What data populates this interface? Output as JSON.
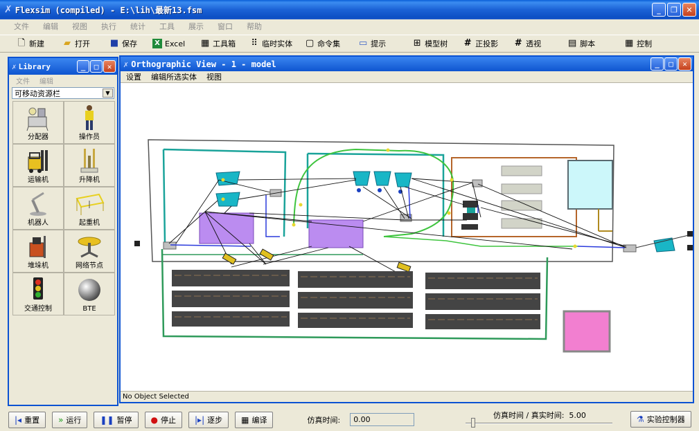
{
  "window": {
    "title": "Flexsim (compiled) - E:\\lih\\最新13.fsm",
    "controls": [
      "_",
      "❐",
      "✕"
    ]
  },
  "menu": [
    "文件",
    "编辑",
    "视图",
    "执行",
    "统计",
    "工具",
    "展示",
    "窗口",
    "帮助"
  ],
  "toolbar": [
    {
      "label": "新建",
      "icon": "new-file-icon",
      "glyph": "🗋"
    },
    {
      "label": "打开",
      "icon": "open-folder-icon",
      "glyph": "📂"
    },
    {
      "label": "保存",
      "icon": "save-disk-icon",
      "glyph": "💾"
    },
    {
      "label": "Excel",
      "icon": "excel-icon",
      "glyph": "X"
    },
    {
      "label": "工具箱",
      "icon": "toolbox-icon",
      "glyph": "▦"
    },
    {
      "label": "临时实体",
      "icon": "flowitem-icon",
      "glyph": "⠿"
    },
    {
      "label": "命令集",
      "icon": "command-icon",
      "glyph": "▢"
    },
    {
      "label": "提示",
      "icon": "tip-icon",
      "glyph": "▭"
    },
    {
      "label": "模型树",
      "icon": "tree-icon",
      "glyph": "⊞"
    },
    {
      "label": "正投影",
      "icon": "ortho-grid-icon",
      "glyph": "#"
    },
    {
      "label": "透视",
      "icon": "perspective-icon",
      "glyph": "#"
    },
    {
      "label": "脚本",
      "icon": "script-icon",
      "glyph": "▤"
    },
    {
      "label": "控制",
      "icon": "control-icon",
      "glyph": "▦"
    }
  ],
  "library": {
    "title": "Library",
    "menu": [
      "文件",
      "编辑"
    ],
    "selected_group": "可移动资源栏",
    "items": [
      {
        "label": "分配器",
        "icon": "dispatcher-icon"
      },
      {
        "label": "操作员",
        "icon": "operator-icon"
      },
      {
        "label": "运输机",
        "icon": "transporter-icon"
      },
      {
        "label": "升降机",
        "icon": "elevator-icon"
      },
      {
        "label": "机器人",
        "icon": "robot-icon"
      },
      {
        "label": "起重机",
        "icon": "crane-icon"
      },
      {
        "label": "堆垛机",
        "icon": "asrs-icon"
      },
      {
        "label": "网络节点",
        "icon": "network-node-icon"
      },
      {
        "label": "交通控制",
        "icon": "traffic-light-icon"
      },
      {
        "label": "BTE",
        "icon": "bte-sphere-icon"
      }
    ]
  },
  "view": {
    "title": "Orthographic View - 1 - model",
    "menu": [
      "设置",
      "编辑所选实体",
      "视图"
    ],
    "status": "No Object Selected"
  },
  "controls": {
    "reset": "重置",
    "run": "运行",
    "pause": "暂停",
    "stop": "停止",
    "step": "逐步",
    "compile": "编译",
    "sim_time_label": "仿真时间:",
    "sim_time_value": "0.00",
    "ratio_label": "仿真时间 / 真实时间:",
    "ratio_value": "5.00",
    "experimenter": "实验控制器"
  },
  "colors": {
    "title_blue": "#0c4fc4",
    "zone_teal": "#1aa39a",
    "path_green": "#3ec43e",
    "processor_purple": "#bb8cf0",
    "queue_cyan": "#ccf7fa",
    "sink_pink": "#f27fd0",
    "rack_dark": "#444444",
    "orange_zone": "#b5652a"
  }
}
